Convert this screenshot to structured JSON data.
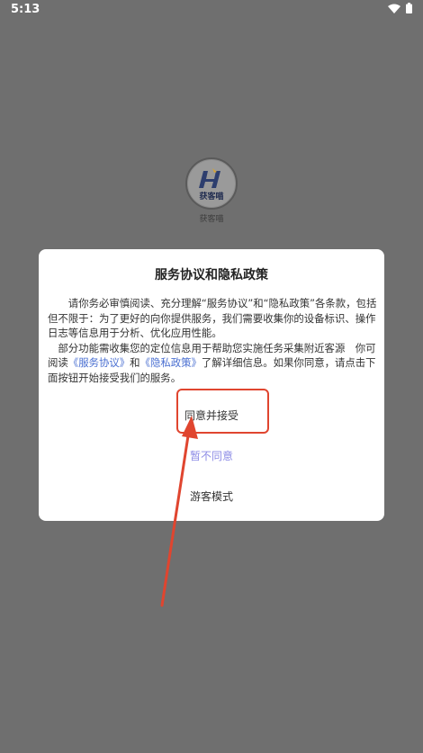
{
  "status_bar": {
    "time": "5:13"
  },
  "app": {
    "logo_text": "获客喵",
    "name": "获客喵"
  },
  "dialog": {
    "title": "服务协议和隐私政策",
    "para1": "请你务必审慎阅读、充分理解“服务协议”和“隐私政策”各条款，包括但不限于：为了更好的向你提供服务，我们需要收集你的设备标识、操作日志等信息用于分析、优化应用性能。",
    "para2_a": "部分功能需收集您的定位信息用于帮助您实施任务采集附近客源　你可阅读",
    "link_service": "《服务协议》",
    "para2_and": "和",
    "link_privacy": "《隐私政策》",
    "para2_b": "了解详细信息。如果你同意，请点击下面按钮开始接受我们的服务。",
    "accept": "同意并接受",
    "decline": "暂不同意",
    "guest": "游客模式"
  },
  "colors": {
    "overlay": "#6f6f6f",
    "link": "#4a6fd1",
    "decline": "#8d8ce6",
    "annotation": "#e0452f"
  }
}
